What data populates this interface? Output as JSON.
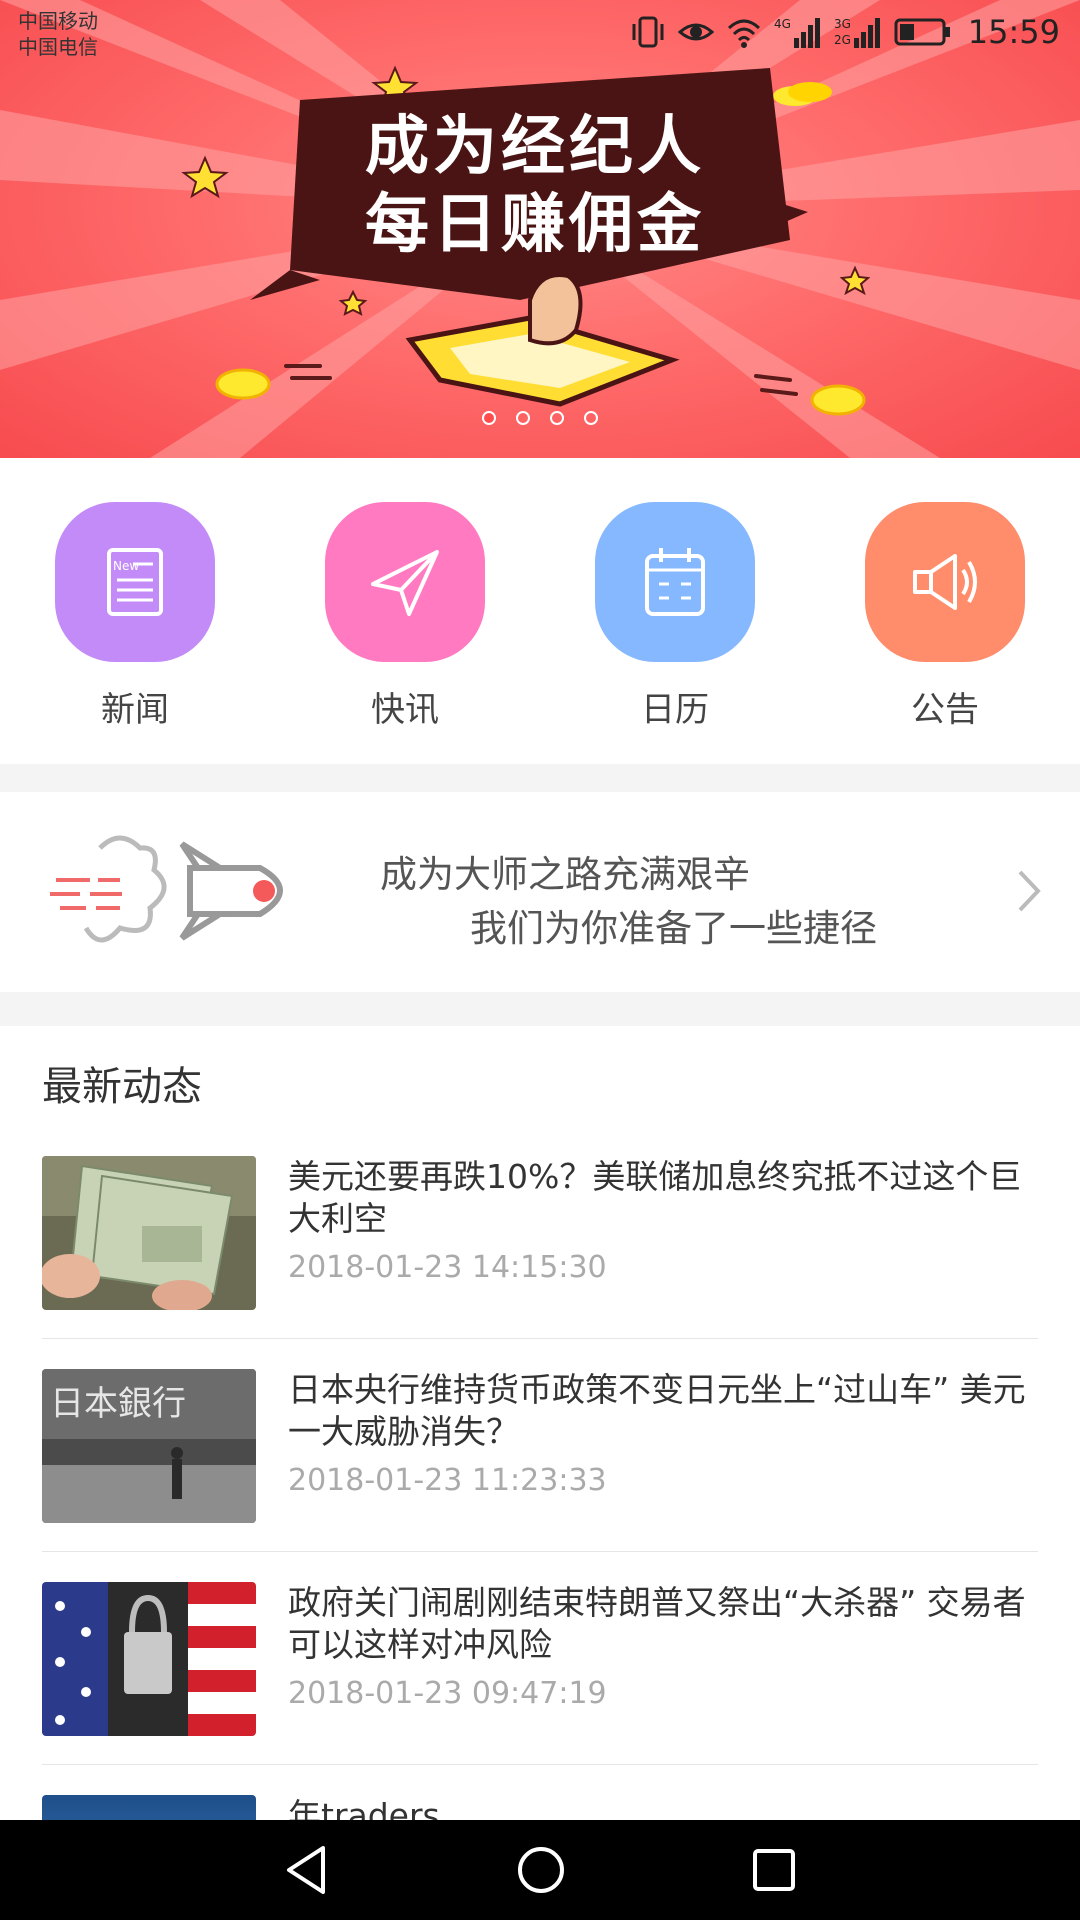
{
  "status": {
    "carrier1": "中国移动",
    "carrier2": "中国电信",
    "time": "15:59",
    "icons": [
      "vibrate-icon",
      "eye-icon",
      "wifi-icon",
      "signal-4g-icon",
      "signal-3g-icon",
      "battery-icon"
    ]
  },
  "banner": {
    "line1": "成为经纪人",
    "line2": "每日赚佣金",
    "page_count": 4,
    "active_page": 1
  },
  "colors": {
    "banner": "#ff6b6b",
    "news_icon": "#c38bf7",
    "flash_icon": "#ff7ac1",
    "calendar_icon": "#86b8ff",
    "notice_icon": "#ff8c6b"
  },
  "quick_menu": [
    {
      "label": "新闻",
      "icon": "newspaper-icon"
    },
    {
      "label": "快讯",
      "icon": "paper-plane-icon"
    },
    {
      "label": "日历",
      "icon": "calendar-icon"
    },
    {
      "label": "公告",
      "icon": "megaphone-icon"
    }
  ],
  "promo": {
    "line1": "成为大师之路充满艰辛",
    "line2": "我们为你准备了一些捷径",
    "icon": "rocket-icon"
  },
  "news": {
    "section_title": "最新动态",
    "items": [
      {
        "title": "美元还要再跌10%？美联储加息终究抵不过这个巨大利空",
        "time": "2018-01-23 14:15:30",
        "thumb": "dollar-bills-photo"
      },
      {
        "title": "日本央行维持货币政策不变日元坐上“过山车” 美元一大威胁消失？",
        "time": "2018-01-23 11:23:33",
        "thumb": "bank-of-japan-photo",
        "thumb_text": "日本銀行"
      },
      {
        "title": "政府关门闹剧刚结束特朗普又祭出“大杀器” 交易者可以这样对冲风险",
        "time": "2018-01-23 09:47:19",
        "thumb": "padlock-flag-photo"
      },
      {
        "title": "年traders",
        "time": "",
        "thumb": "blue-photo"
      }
    ]
  }
}
